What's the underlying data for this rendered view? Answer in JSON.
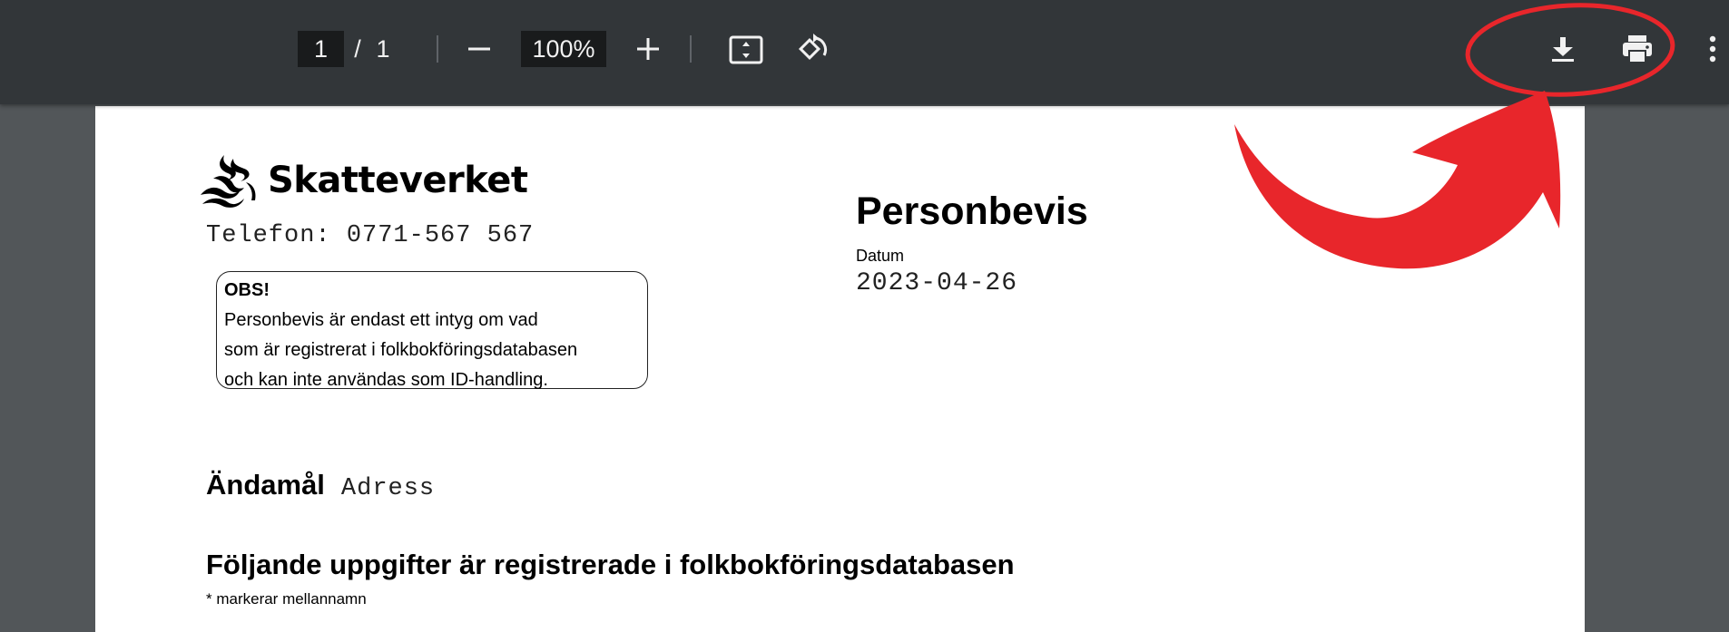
{
  "toolbar": {
    "page_current": "1",
    "page_separator": "/",
    "page_total": "1",
    "zoom_level": "100%",
    "icons": [
      "zoom-out-icon",
      "zoom-in-icon",
      "fit-page-icon",
      "rotate-icon",
      "download-icon",
      "print-icon",
      "more-vert-icon"
    ]
  },
  "document": {
    "logo_text": "Skatteverket",
    "phone": "Telefon: 0771-567 567",
    "notice": {
      "title": "OBS!",
      "lines": [
        "Personbevis är endast ett intyg om vad",
        "som är registrerat i folkbokföringsdatabasen",
        "och kan inte användas som ID-handling."
      ]
    },
    "title": "Personbevis",
    "date_label": "Datum",
    "date_value": "2023-04-26",
    "purpose_label": "Ändamål",
    "purpose_value": "Adress",
    "section_title": "Följande uppgifter är registrerade i folkbokföringsdatabasen",
    "section_note": "* markerar mellannamn"
  },
  "colors": {
    "toolbar_bg": "#323639",
    "viewer_bg": "#525659",
    "annotation_red": "#e8262b"
  }
}
